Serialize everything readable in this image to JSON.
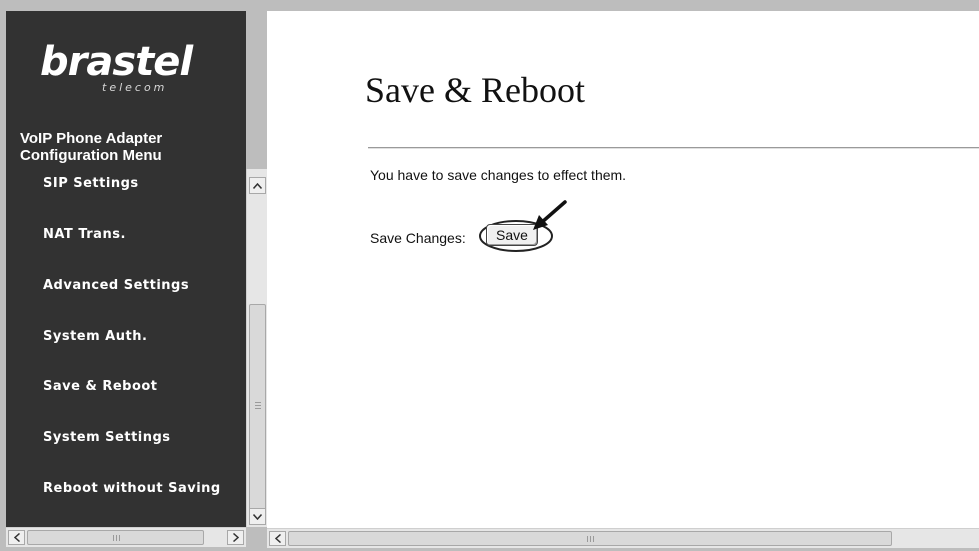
{
  "logo": {
    "brand": "brastel",
    "sub": "telecom"
  },
  "sidebar": {
    "heading_line1": "VoIP Phone Adapter",
    "heading_line2": "Configuration Menu",
    "items": [
      {
        "label": "SIP Settings"
      },
      {
        "label": "NAT Trans."
      },
      {
        "label": "Advanced Settings"
      },
      {
        "label": "System Auth."
      },
      {
        "label": "Save & Reboot"
      },
      {
        "label": "System Settings"
      },
      {
        "label": "Reboot without Saving"
      }
    ]
  },
  "main": {
    "title": "Save & Reboot",
    "hint": "You have to save changes to effect them.",
    "save_label": "Save Changes:",
    "save_button": "Save"
  },
  "icons": {
    "scroll_up": "scroll-up-arrow-icon",
    "scroll_down": "scroll-down-arrow-icon",
    "scroll_left": "scroll-left-arrow-icon",
    "scroll_right": "scroll-right-arrow-icon",
    "pointer": "pointer-arrow-icon"
  }
}
